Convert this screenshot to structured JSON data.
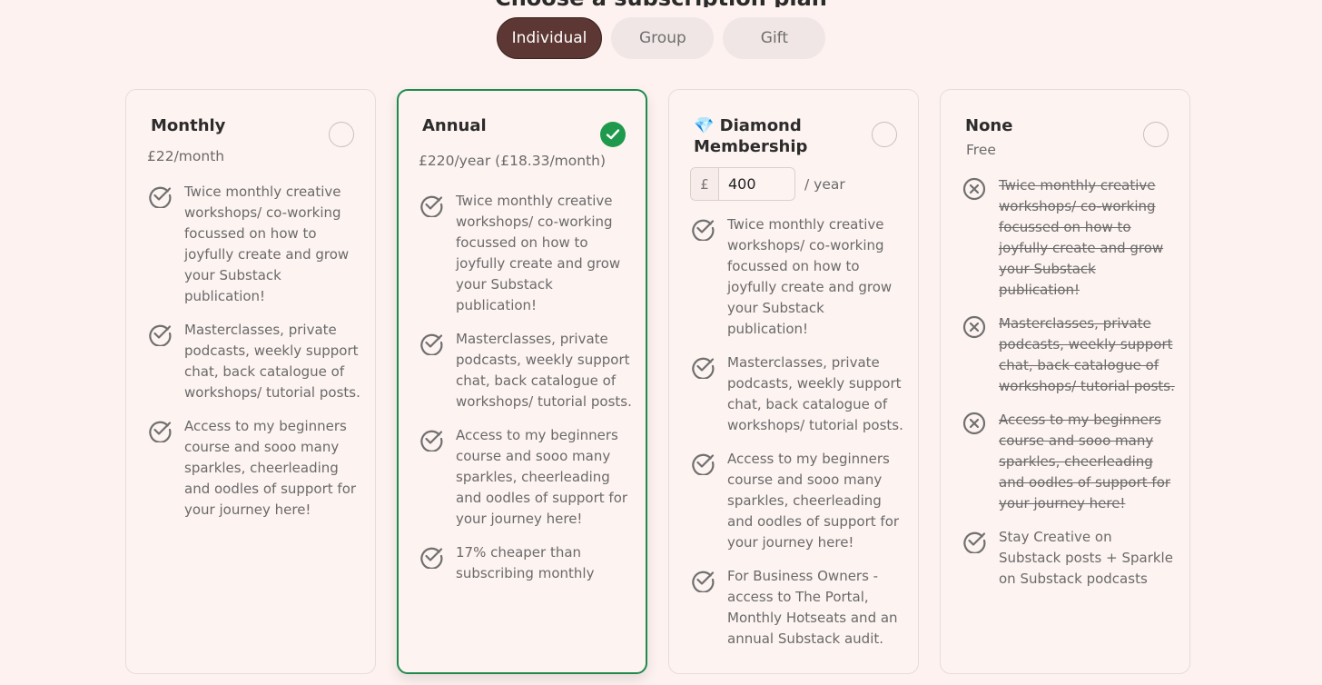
{
  "heading": "Choose a subscription plan",
  "tabs": [
    {
      "label": "Individual",
      "active": true
    },
    {
      "label": "Group",
      "active": false
    },
    {
      "label": "Gift",
      "active": false
    }
  ],
  "plans": [
    {
      "title": "Monthly",
      "price": "£22/month",
      "selected": false,
      "features": [
        {
          "text": "Twice monthly creative workshops/ co-working focussed on how to joyfully create and grow your Substack publication!",
          "included": true
        },
        {
          "text": "Masterclasses, private podcasts, weekly support chat, back catalogue of workshops/ tutorial posts.",
          "included": true
        },
        {
          "text": "Access to my beginners course and sooo many sparkles, cheerleading and oodles of support for your journey here!",
          "included": true
        }
      ]
    },
    {
      "title": "Annual",
      "price": "£220/year (£18.33/month)",
      "selected": true,
      "features": [
        {
          "text": "Twice monthly creative workshops/ co-working focussed on how to joyfully create and grow your Substack publication!",
          "included": true
        },
        {
          "text": "Masterclasses, private podcasts, weekly support chat, back catalogue of workshops/ tutorial posts.",
          "included": true
        },
        {
          "text": "Access to my beginners course and sooo many sparkles, cheerleading and oodles of support for your journey here!",
          "included": true
        },
        {
          "text": "17% cheaper than subscribing monthly",
          "included": true
        }
      ]
    },
    {
      "title": "💎 Diamond Membership",
      "currency": "£",
      "amount": "400",
      "per": "/ year",
      "selected": false,
      "features": [
        {
          "text": "Twice monthly creative workshops/ co-working focussed on how to joyfully create and grow your Substack publication!",
          "included": true
        },
        {
          "text": "Masterclasses, private podcasts, weekly support chat, back catalogue of workshops/ tutorial posts.",
          "included": true
        },
        {
          "text": "Access to my beginners course and sooo many sparkles, cheerleading and oodles of support for your journey here!",
          "included": true
        },
        {
          "text": "For Business Owners - access to The Portal, Monthly Hotseats and an annual Substack audit.",
          "included": true
        }
      ]
    },
    {
      "title": "None",
      "price": "Free",
      "selected": false,
      "features": [
        {
          "text": "Twice monthly creative workshops/ co-working focussed on how to joyfully create and grow your Substack publication!",
          "included": false
        },
        {
          "text": "Masterclasses, private podcasts, weekly support chat, back catalogue of workshops/ tutorial posts.",
          "included": false
        },
        {
          "text": "Access to my beginners course and sooo many sparkles, cheerleading and oodles of support for your journey here!",
          "included": false
        },
        {
          "text": "Stay Creative on Substack posts + Sparkle on Substack podcasts",
          "included": true
        }
      ]
    }
  ],
  "colors": {
    "background": "#fdf2f0",
    "active_tab": "#5c3733",
    "selected_border": "#1f8a4c",
    "check_fill": "#1f9a4c"
  },
  "icons": {
    "included": "check-circle-icon",
    "excluded": "x-circle-icon",
    "selected": "checkmark-icon"
  }
}
